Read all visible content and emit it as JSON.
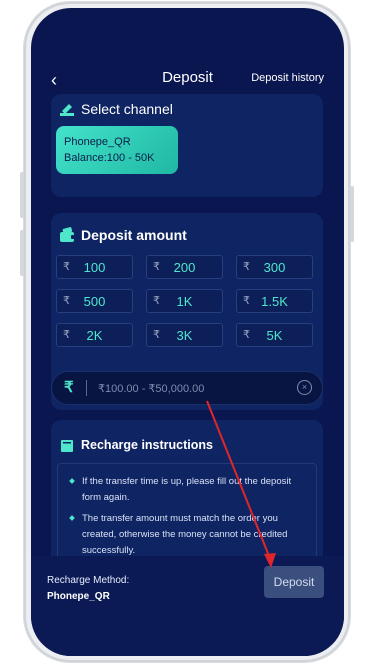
{
  "header": {
    "back_icon": "chevron-left-icon",
    "back_glyph": "‹",
    "title": "Deposit",
    "history_link": "Deposit history"
  },
  "select_channel": {
    "title": "Select channel",
    "channel": {
      "name": "Phonepe_QR",
      "balance": "Balance:100 - 50K"
    }
  },
  "deposit_amount": {
    "title": "Deposit amount",
    "currency_symbol": "₹",
    "amounts": [
      "100",
      "200",
      "300",
      "500",
      "1K",
      "1.5K",
      "2K",
      "3K",
      "5K"
    ],
    "input": {
      "value": "",
      "placeholder": "₹100.00 - ₹50,000.00",
      "clear_glyph": "×"
    }
  },
  "recharge_instructions": {
    "title": "Recharge instructions",
    "items": [
      "If the transfer time is up, please fill out the deposit form again.",
      "The transfer amount must match the order you created, otherwise the money cannot be credited successfully."
    ]
  },
  "footer": {
    "method_label": "Recharge Method:",
    "method_value": "Phonepe_QR",
    "deposit_button": "Deposit"
  },
  "colors": {
    "background": "#0a1650",
    "card": "#0f2463",
    "accent": "#4fe7cc",
    "annotation_arrow": "#e0262b"
  }
}
